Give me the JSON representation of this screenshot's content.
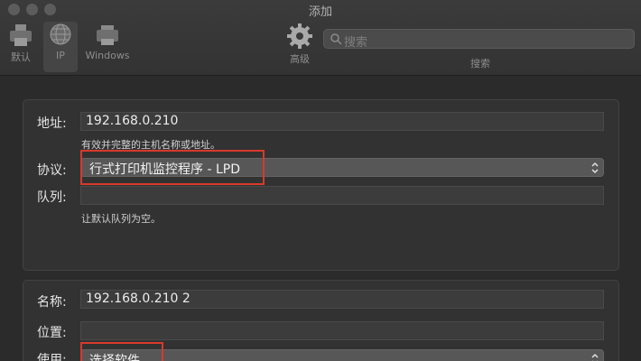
{
  "window": {
    "title": "添加"
  },
  "toolbar": {
    "items": [
      {
        "label": "默认",
        "icon": "default-printer-icon"
      },
      {
        "label": "IP",
        "icon": "ip-globe-icon",
        "selected": true
      },
      {
        "label": "Windows",
        "icon": "windows-printer-icon"
      },
      {
        "label": "高级",
        "icon": "gear-icon"
      }
    ],
    "search": {
      "placeholder": "搜索",
      "label": "搜索"
    }
  },
  "connection": {
    "address_label": "地址:",
    "address_value": "192.168.0.210",
    "address_hint": "有效并完整的主机名称或地址。",
    "protocol_label": "协议:",
    "protocol_value": "行式打印机监控程序 - LPD",
    "queue_label": "队列:",
    "queue_value": "",
    "queue_hint": "让默认队列为空。"
  },
  "details": {
    "name_label": "名称:",
    "name_value": "192.168.0.210 2",
    "location_label": "位置:",
    "location_value": "",
    "use_label": "使用:",
    "use_value": "选择软件..."
  },
  "colors": {
    "highlight": "#d8392b",
    "background": "#2b2b2b"
  }
}
